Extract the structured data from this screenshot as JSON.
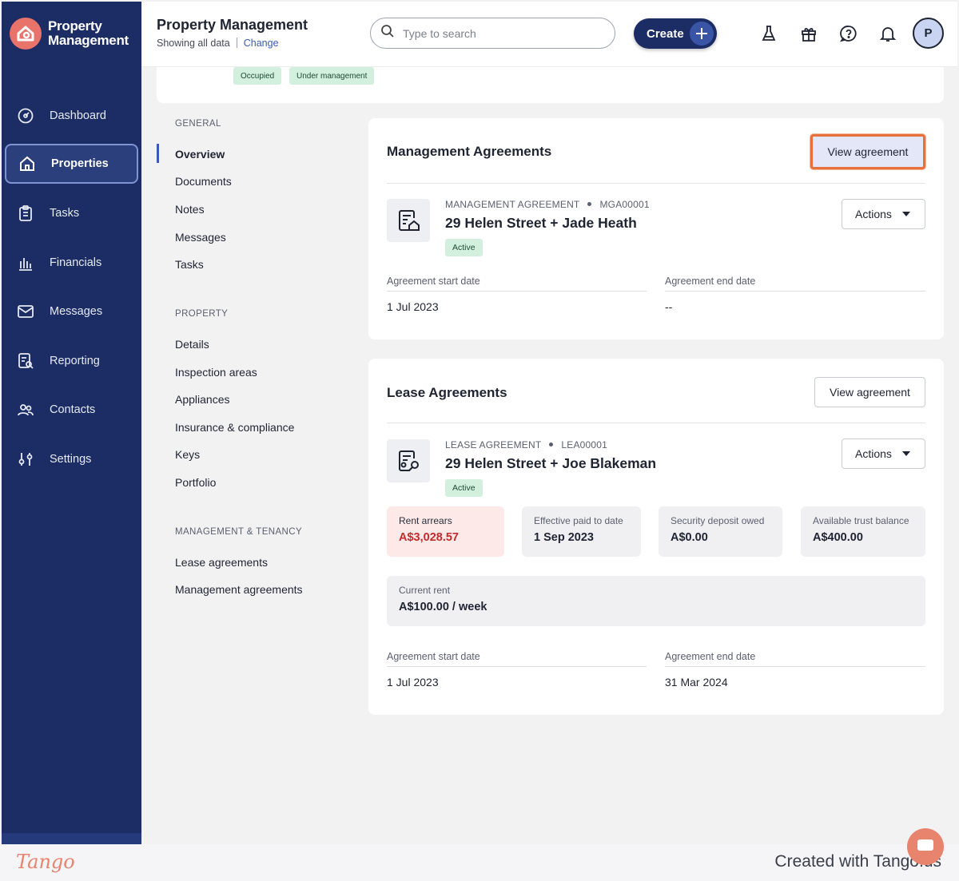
{
  "app": {
    "brand_line1": "Property",
    "brand_line2": "Management"
  },
  "sidebar": {
    "items": [
      {
        "label": "Dashboard",
        "icon": "dashboard-icon"
      },
      {
        "label": "Properties",
        "icon": "home-icon",
        "active": true
      },
      {
        "label": "Tasks",
        "icon": "clipboard-icon"
      },
      {
        "label": "Financials",
        "icon": "bank-icon"
      },
      {
        "label": "Messages",
        "icon": "mail-icon"
      },
      {
        "label": "Reporting",
        "icon": "report-icon"
      },
      {
        "label": "Contacts",
        "icon": "people-icon"
      },
      {
        "label": "Settings",
        "icon": "sliders-icon"
      }
    ]
  },
  "topbar": {
    "title": "Property Management",
    "subtitle": "Showing all data",
    "change_link": "Change",
    "search_placeholder": "Type to search",
    "create_label": "Create",
    "avatar_initial": "P"
  },
  "property": {
    "tags": [
      "Occupied",
      "Under management"
    ]
  },
  "subnav": {
    "general_heading": "GENERAL",
    "general_items": [
      "Overview",
      "Documents",
      "Notes",
      "Messages",
      "Tasks"
    ],
    "property_heading": "PROPERTY",
    "property_items": [
      "Details",
      "Inspection areas",
      "Appliances",
      "Insurance & compliance",
      "Keys",
      "Portfolio"
    ],
    "mgmt_heading": "MANAGEMENT & TENANCY",
    "mgmt_items": [
      "Lease agreements",
      "Management agreements"
    ]
  },
  "management": {
    "title": "Management Agreements",
    "view_button": "View agreement",
    "kicker_type": "MANAGEMENT AGREEMENT",
    "kicker_id": "MGA00001",
    "agreement_title": "29 Helen Street + Jade Heath",
    "status": "Active",
    "actions_label": "Actions",
    "start_label": "Agreement start date",
    "start_value": "1 Jul 2023",
    "end_label": "Agreement end date",
    "end_value": "--"
  },
  "lease": {
    "title": "Lease Agreements",
    "view_button": "View agreement",
    "kicker_type": "LEASE AGREEMENT",
    "kicker_id": "LEA00001",
    "agreement_title": "29 Helen Street + Joe Blakeman",
    "status": "Active",
    "actions_label": "Actions",
    "stats": {
      "arrears_label": "Rent arrears",
      "arrears_value": "A$3,028.57",
      "paid_label": "Effective paid to date",
      "paid_value": "1 Sep 2023",
      "deposit_label": "Security deposit owed",
      "deposit_value": "A$0.00",
      "trust_label": "Available trust balance",
      "trust_value": "A$400.00"
    },
    "rent_label": "Current rent",
    "rent_value": "A$100.00 / week",
    "start_label": "Agreement start date",
    "start_value": "1 Jul 2023",
    "end_label": "Agreement end date",
    "end_value": "31 Mar 2024"
  },
  "footer": {
    "logo_text": "Tango",
    "created_text": "Created with Tango.us"
  },
  "colors": {
    "sidebar_bg": "#1b2d64",
    "accent": "#3a5bb3",
    "highlight": "#e8703d",
    "success_bg": "#d3efdd",
    "danger": "#c72a2a"
  }
}
